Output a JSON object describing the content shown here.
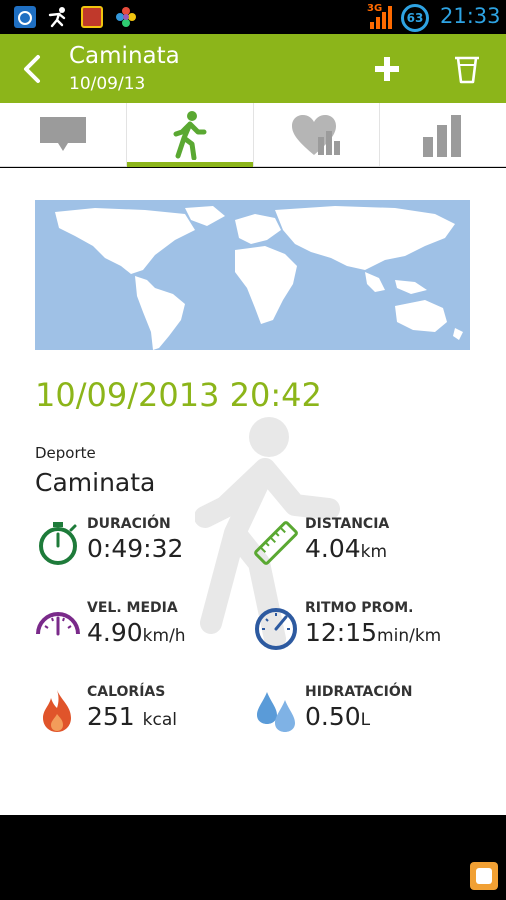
{
  "status_bar": {
    "network": "3G",
    "battery": "63",
    "time": "21:33",
    "icons": [
      "outlook-icon",
      "running-app-icon",
      "game-icon",
      "flower-icon"
    ]
  },
  "action_bar": {
    "title": "Caminata",
    "subtitle": "10/09/13",
    "background": "#8cb51a"
  },
  "tabs": [
    {
      "name": "comments",
      "icon": "speech-bubble-icon",
      "active": false
    },
    {
      "name": "activity",
      "icon": "walker-icon",
      "active": true
    },
    {
      "name": "heart-stats",
      "icon": "heart-chart-icon",
      "active": false
    },
    {
      "name": "charts",
      "icon": "bar-chart-icon",
      "active": false
    }
  ],
  "workout": {
    "datetime": "10/09/2013 20:42",
    "sport_label": "Deporte",
    "sport_value": "Caminata"
  },
  "stats": {
    "duration": {
      "label": "DURACIÓN",
      "value": "0:49:32",
      "unit": "",
      "color": "#1e7b3a"
    },
    "distance": {
      "label": "DISTANCIA",
      "value": "4.04",
      "unit": "km",
      "color": "#5aa832"
    },
    "avg_speed": {
      "label": "VEL. MEDIA",
      "value": "4.90",
      "unit": "km/h",
      "color": "#7a2a8a"
    },
    "pace": {
      "label": "RITMO PROM.",
      "value": "12:15",
      "unit": "min/km",
      "color": "#2d5aa0"
    },
    "calories": {
      "label": "CALORÍAS",
      "value": "251",
      "unit": "kcal",
      "color": "#e0542a"
    },
    "hydration": {
      "label": "HIDRATACIÓN",
      "value": "0.50",
      "unit": "L",
      "color": "#5a9bd8"
    }
  },
  "colors": {
    "accent": "#8cb51a",
    "map_water": "#9fc1e6",
    "map_land": "#ffffff"
  }
}
